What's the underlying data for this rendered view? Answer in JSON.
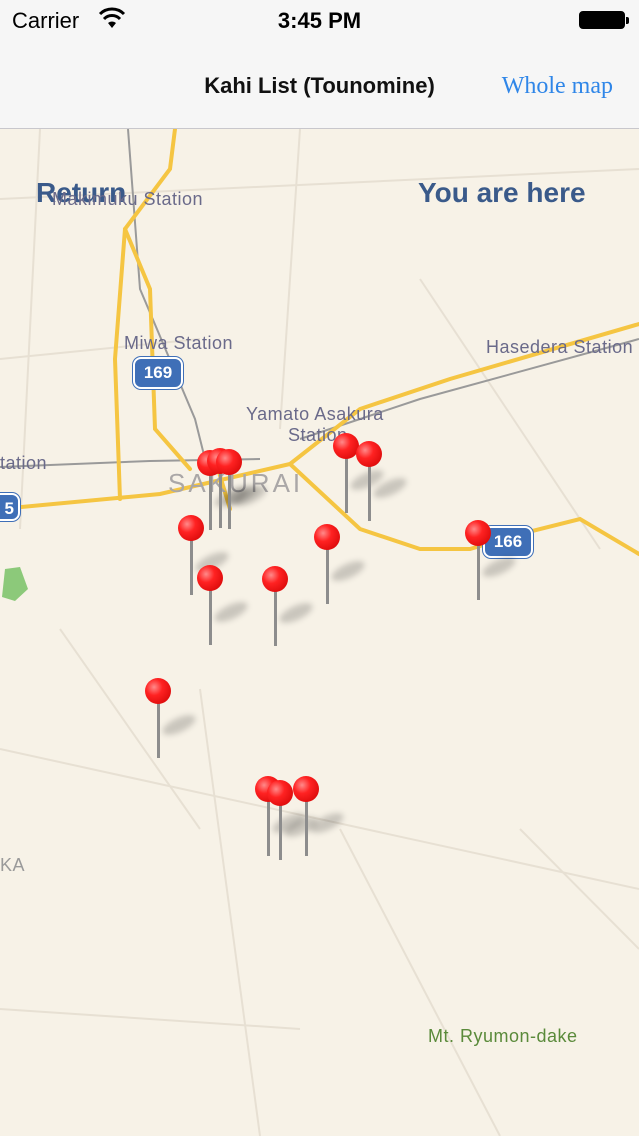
{
  "status_bar": {
    "carrier": "Carrier",
    "time": "3:45 PM"
  },
  "nav": {
    "title": "Kahi List (Tounomine)",
    "right_button": "Whole map"
  },
  "map": {
    "return_button": "Return",
    "location_button": "You are here",
    "labels": {
      "makimuku": "Makimuku Station",
      "miwa": "Miwa Station",
      "hasedera": "Hasedera Station",
      "yamato_asakura": "Yamato Asakura",
      "station": "Station",
      "tation": "tation",
      "sakurai": "SAKURAI",
      "ka": "KA",
      "ryumon": "Mt. Ryumon-dake"
    },
    "route_shields": {
      "r169": "169",
      "r166": "166",
      "r165": "5"
    },
    "pin_count": 16,
    "colors": {
      "pin": "#e82020",
      "road": "#f5c542",
      "link": "#2f86e8"
    }
  }
}
